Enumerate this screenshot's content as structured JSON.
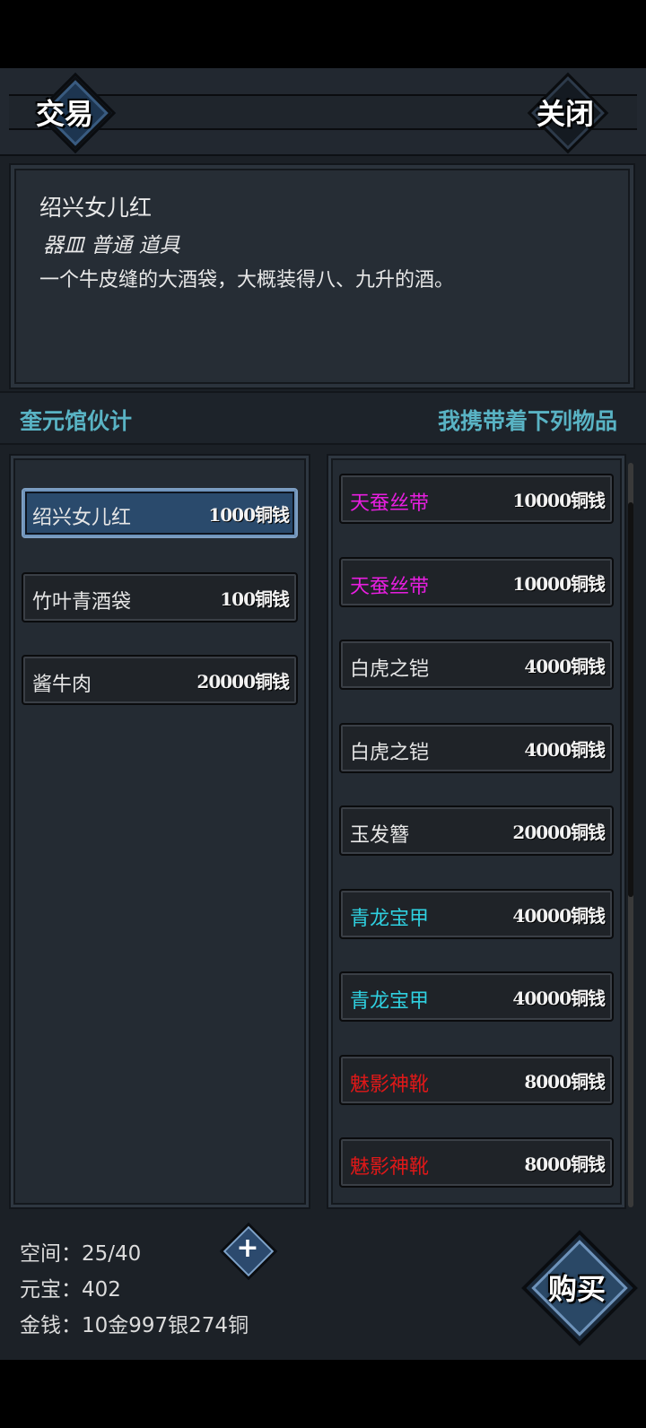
{
  "header": {
    "title": "交易",
    "close_label": "关闭"
  },
  "description": {
    "name": "绍兴女儿红",
    "subtitle": "器皿 普通 道具",
    "text": "一个牛皮缝的大酒袋，大概装得八、九升的酒。"
  },
  "labels": {
    "merchant": "奎元馆伙计",
    "inventory": "我携带着下列物品"
  },
  "colors": {
    "magenta": "#e81ee0",
    "cyan": "#2fd0e0",
    "red": "#e01818",
    "white": "#e6e6e6"
  },
  "merchant_items": [
    {
      "name": "绍兴女儿红",
      "price": "1000铜钱",
      "selected": true
    },
    {
      "name": "竹叶青酒袋",
      "price": "100铜钱"
    },
    {
      "name": "酱牛肉",
      "price": "20000铜钱"
    }
  ],
  "inventory_items": [
    {
      "name": "天蚕丝带",
      "price": "10000铜钱",
      "color": "#e81ee0"
    },
    {
      "name": "天蚕丝带",
      "price": "10000铜钱",
      "color": "#e81ee0"
    },
    {
      "name": "白虎之铠",
      "price": "4000铜钱",
      "color": "#e6e6e6"
    },
    {
      "name": "白虎之铠",
      "price": "4000铜钱",
      "color": "#e6e6e6"
    },
    {
      "name": "玉发簪",
      "price": "20000铜钱",
      "color": "#e6e6e6"
    },
    {
      "name": "青龙宝甲",
      "price": "40000铜钱",
      "color": "#2fd0e0"
    },
    {
      "name": "青龙宝甲",
      "price": "40000铜钱",
      "color": "#2fd0e0"
    },
    {
      "name": "魅影神靴",
      "price": "8000铜钱",
      "color": "#e01818"
    },
    {
      "name": "魅影神靴",
      "price": "8000铜钱",
      "color": "#e01818"
    }
  ],
  "footer": {
    "space": "空间：25/40",
    "yuanbao": "元宝：402",
    "money": "金钱：10金997银274铜",
    "buy_label": "购买"
  }
}
